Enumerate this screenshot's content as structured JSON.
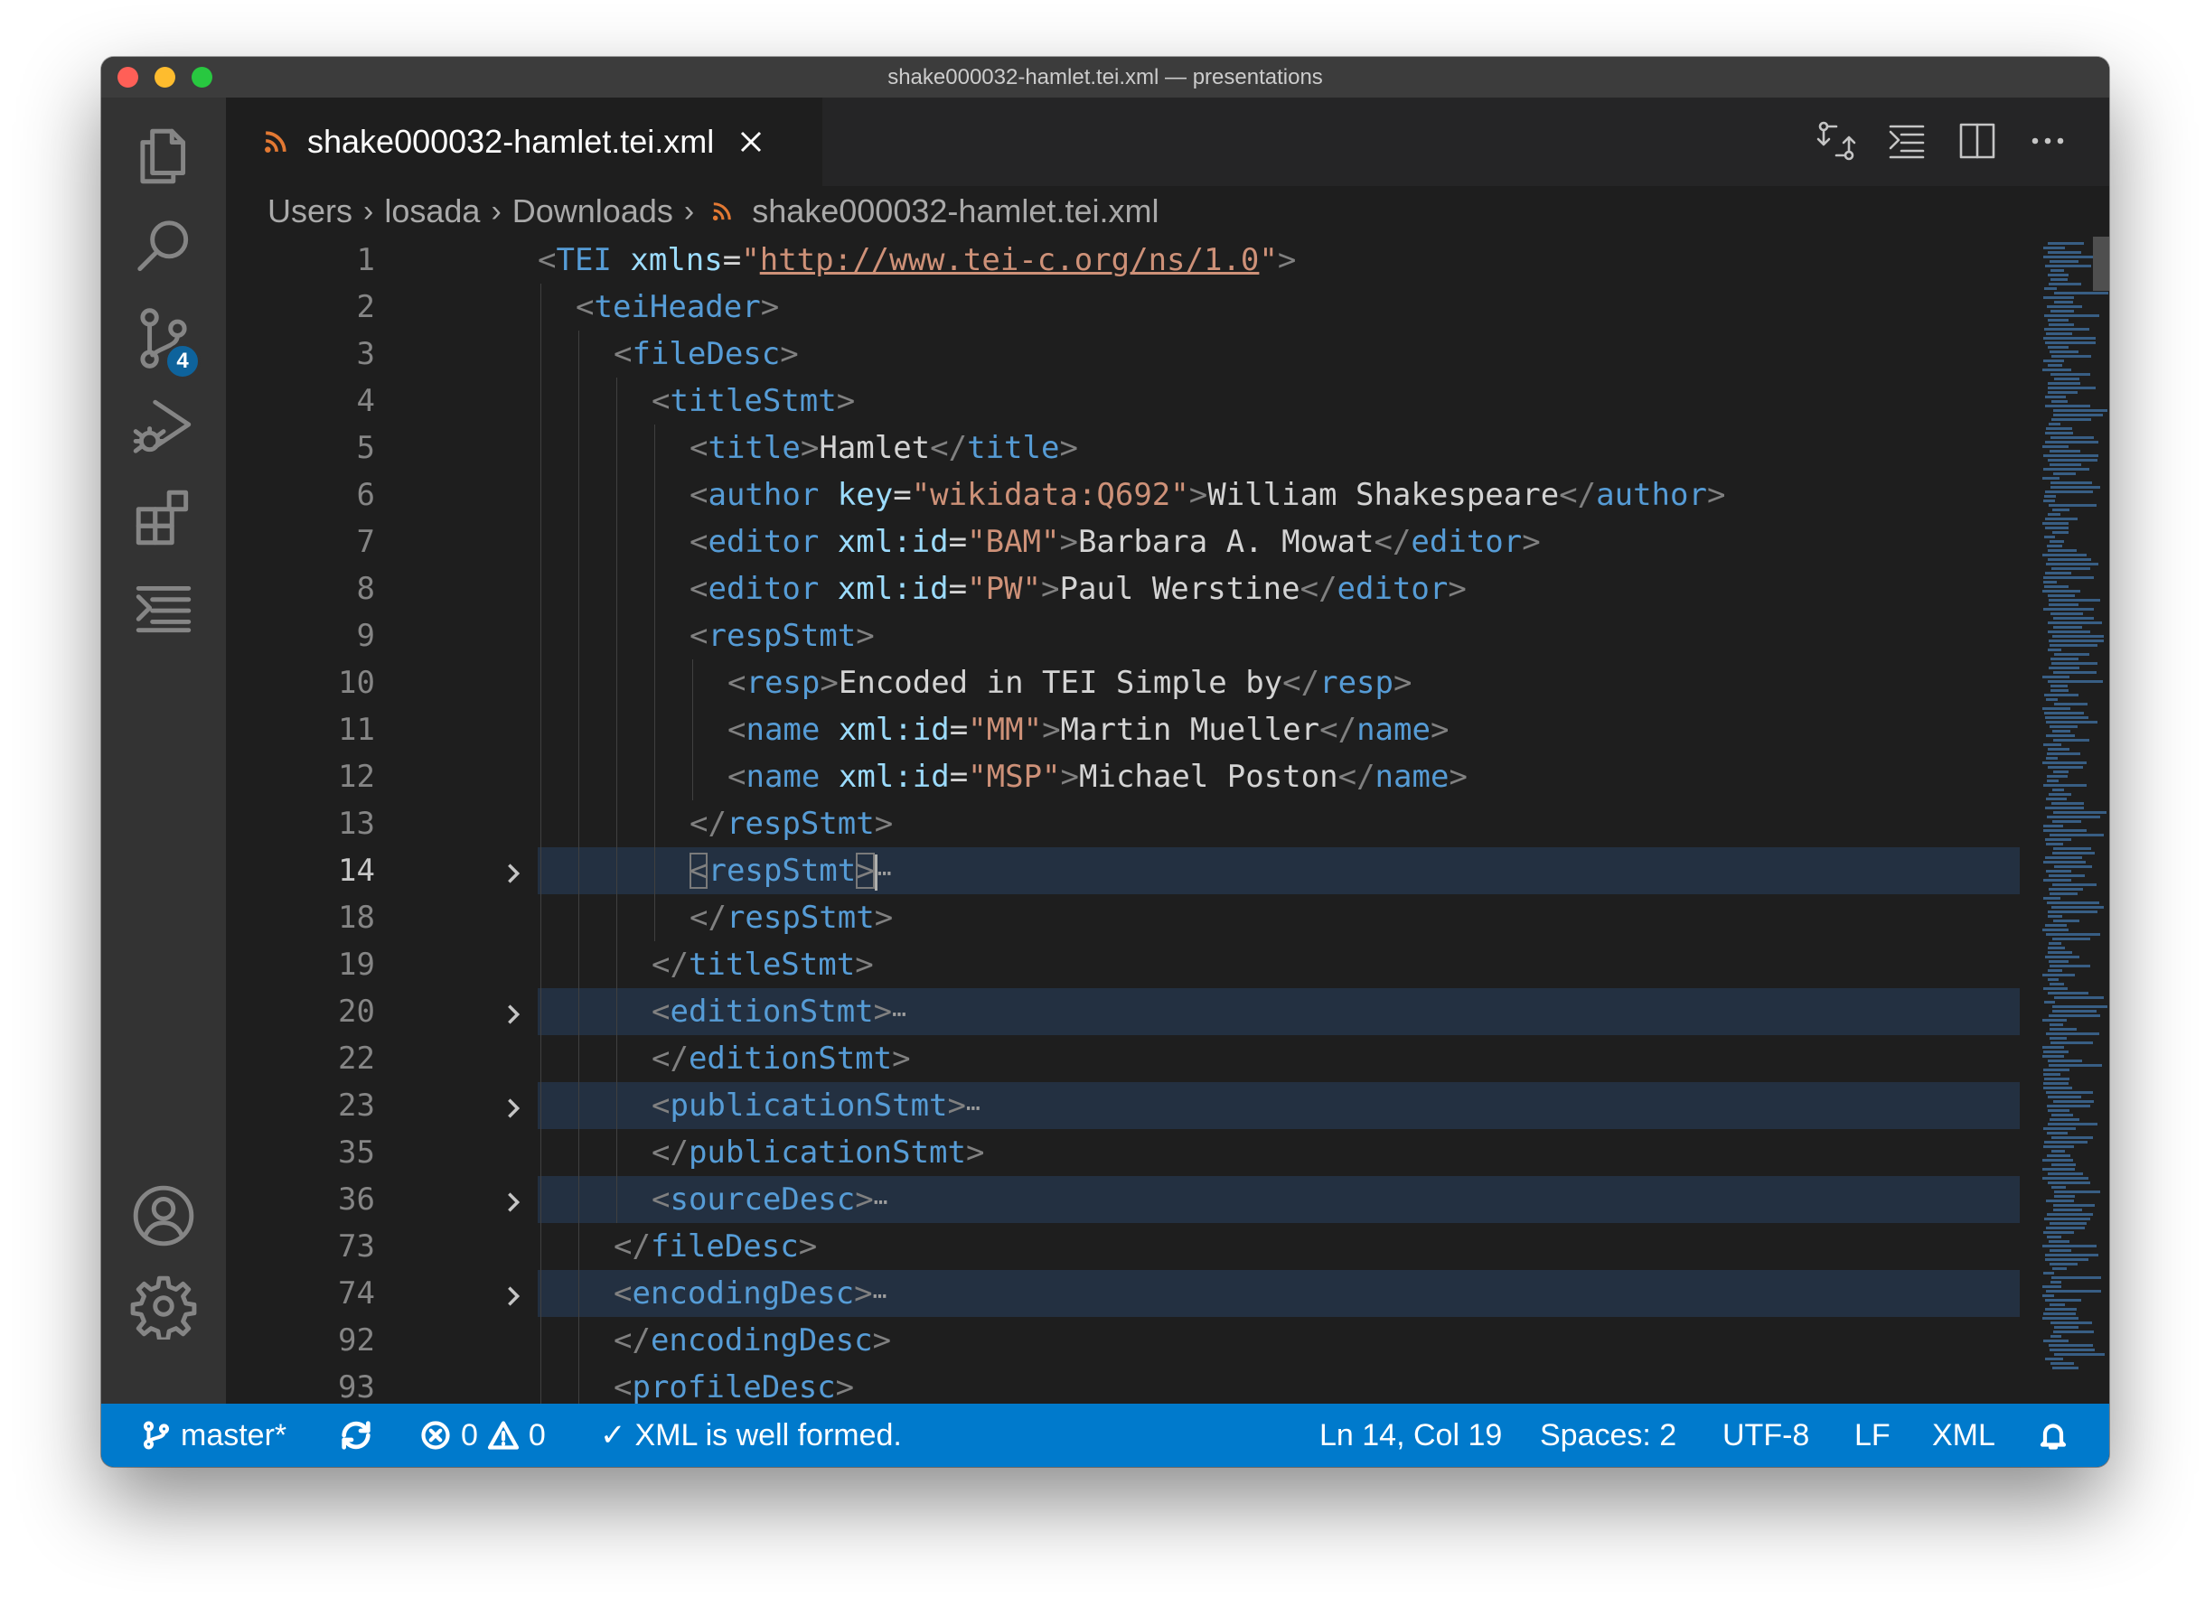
{
  "window": {
    "title": "shake000032-hamlet.tei.xml — presentations"
  },
  "activity_bar": {
    "items": [
      "explorer",
      "search",
      "source-control",
      "run-and-debug",
      "extensions",
      "outline"
    ],
    "source_control_badge": "4",
    "bottom_items": [
      "accounts",
      "manage"
    ]
  },
  "tab": {
    "filename": "shake000032-hamlet.tei.xml",
    "icon": "rss-icon"
  },
  "breadcrumb": [
    "Users",
    "losada",
    "Downloads",
    "shake000032-hamlet.tei.xml"
  ],
  "editor": {
    "line_numbers": [
      "1",
      "2",
      "3",
      "4",
      "5",
      "6",
      "7",
      "8",
      "9",
      "10",
      "11",
      "12",
      "13",
      "14",
      "18",
      "19",
      "20",
      "22",
      "23",
      "35",
      "36",
      "73",
      "74",
      "92",
      "93"
    ],
    "folded_lines": [
      "14",
      "20",
      "23",
      "36",
      "74"
    ],
    "current_line": "14",
    "text": {
      "l1_tag": "TEI",
      "l1_attr": "xmlns",
      "l1_url": "http://www.tei-c.org/ns/1.0",
      "l2_tag": "teiHeader",
      "l3_tag": "fileDesc",
      "l4_tag": "titleStmt",
      "l5_tag": "title",
      "l5_text": "Hamlet",
      "l6_tag": "author",
      "l6_attr": "key",
      "l6_val": "\"wikidata:Q692\"",
      "l6_text": "William Shakespeare",
      "l7_tag": "editor",
      "l7_attr": "xml:id",
      "l7_val": "\"BAM\"",
      "l7_text": "Barbara A. Mowat",
      "l8_tag": "editor",
      "l8_attr": "xml:id",
      "l8_val": "\"PW\"",
      "l8_text": "Paul Werstine",
      "l9_tag": "respStmt",
      "l10_tag": "resp",
      "l10_text": "Encoded in TEI Simple by",
      "l11_tag": "name",
      "l11_attr": "xml:id",
      "l11_val": "\"MM\"",
      "l11_text": "Martin Mueller",
      "l12_tag": "name",
      "l12_attr": "xml:id",
      "l12_val": "\"MSP\"",
      "l12_text": "Michael Poston",
      "l13_tag": "respStmt",
      "l14_tag": "respStmt",
      "l18_tag": "respStmt",
      "l19_tag": "titleStmt",
      "l20_tag": "editionStmt",
      "l22_tag": "editionStmt",
      "l23_tag": "publicationStmt",
      "l35_tag": "publicationStmt",
      "l36_tag": "sourceDesc",
      "l73_tag": "fileDesc",
      "l74_tag": "encodingDesc",
      "l92_tag": "encodingDesc",
      "l93_tag": "profileDesc",
      "ellipsis": "⋯"
    }
  },
  "status_bar": {
    "branch": "master*",
    "errors": "0",
    "warnings": "0",
    "validation": "XML is well formed.",
    "position": "Ln 14, Col 19",
    "spaces": "Spaces: 2",
    "encoding": "UTF-8",
    "eol": "LF",
    "language": "XML"
  },
  "colors": {
    "status_bar": "#007acc",
    "tag": "#569cd6",
    "attribute": "#9cdcfe",
    "string": "#ce9178",
    "badge": "#0e639c"
  }
}
